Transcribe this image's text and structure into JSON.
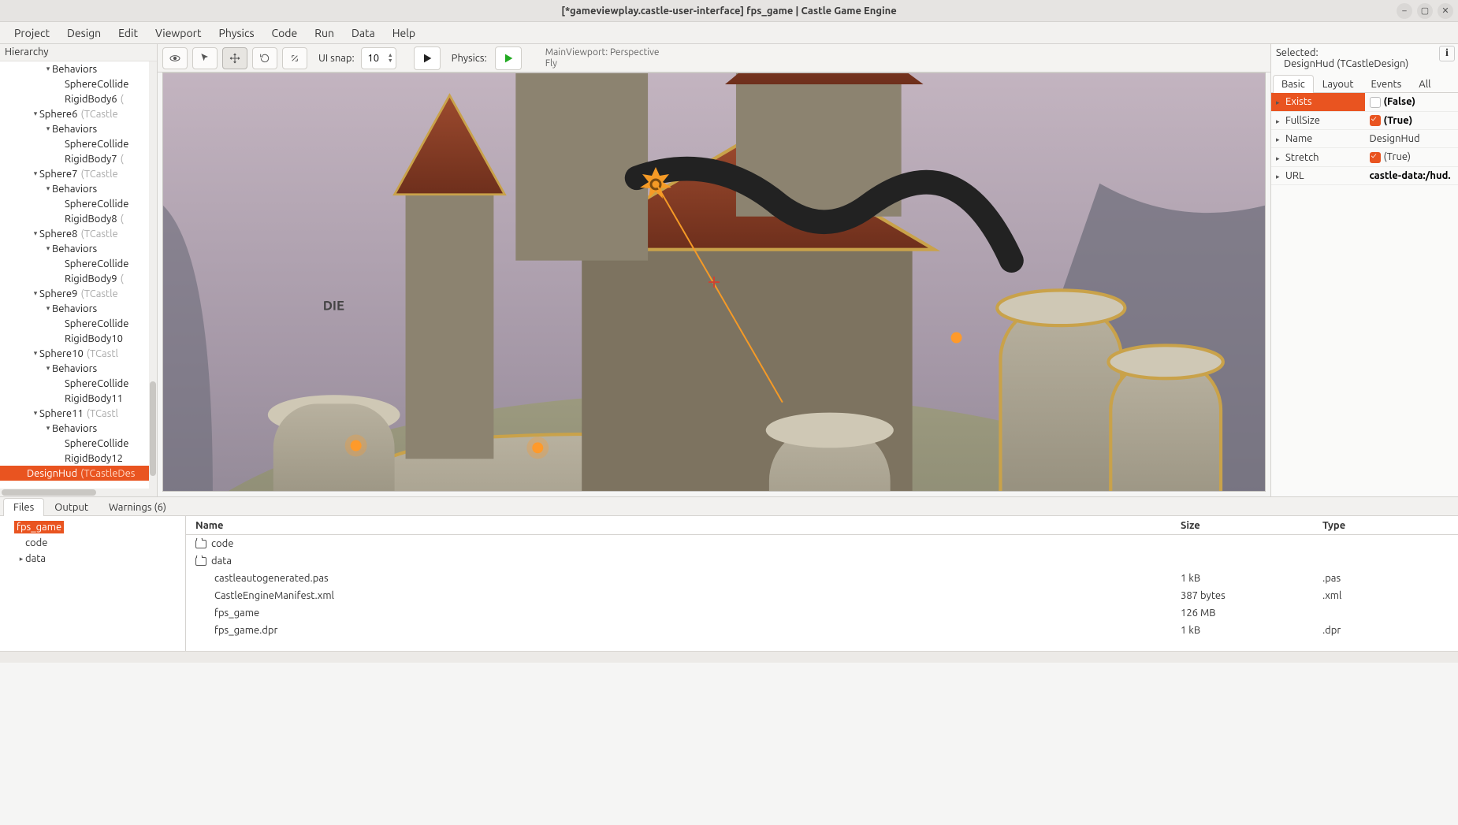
{
  "titlebar": {
    "title": "[*gameviewplay.castle-user-interface] fps_game | Castle Game Engine"
  },
  "menu": [
    "Project",
    "Design",
    "Edit",
    "Viewport",
    "Physics",
    "Code",
    "Run",
    "Data",
    "Help"
  ],
  "toolbar": {
    "ui_snap_label": "UI snap:",
    "ui_snap_value": "10",
    "physics_label": "Physics:",
    "info_line1": "MainViewport: Perspective",
    "info_line2": "Fly"
  },
  "hierarchy": {
    "header": "Hierarchy",
    "rows": [
      {
        "indent": 3,
        "arrow": "▾",
        "label": "Behaviors",
        "type": ""
      },
      {
        "indent": 4,
        "arrow": "",
        "label": "SphereCollide",
        "type": ""
      },
      {
        "indent": 4,
        "arrow": "",
        "label": "RigidBody6",
        "type": "("
      },
      {
        "indent": 2,
        "arrow": "▾",
        "label": "Sphere6",
        "type": "(TCastle"
      },
      {
        "indent": 3,
        "arrow": "▾",
        "label": "Behaviors",
        "type": ""
      },
      {
        "indent": 4,
        "arrow": "",
        "label": "SphereCollide",
        "type": ""
      },
      {
        "indent": 4,
        "arrow": "",
        "label": "RigidBody7",
        "type": "("
      },
      {
        "indent": 2,
        "arrow": "▾",
        "label": "Sphere7",
        "type": "(TCastle"
      },
      {
        "indent": 3,
        "arrow": "▾",
        "label": "Behaviors",
        "type": ""
      },
      {
        "indent": 4,
        "arrow": "",
        "label": "SphereCollide",
        "type": ""
      },
      {
        "indent": 4,
        "arrow": "",
        "label": "RigidBody8",
        "type": "("
      },
      {
        "indent": 2,
        "arrow": "▾",
        "label": "Sphere8",
        "type": "(TCastle"
      },
      {
        "indent": 3,
        "arrow": "▾",
        "label": "Behaviors",
        "type": ""
      },
      {
        "indent": 4,
        "arrow": "",
        "label": "SphereCollide",
        "type": ""
      },
      {
        "indent": 4,
        "arrow": "",
        "label": "RigidBody9",
        "type": "("
      },
      {
        "indent": 2,
        "arrow": "▾",
        "label": "Sphere9",
        "type": "(TCastle"
      },
      {
        "indent": 3,
        "arrow": "▾",
        "label": "Behaviors",
        "type": ""
      },
      {
        "indent": 4,
        "arrow": "",
        "label": "SphereCollide",
        "type": ""
      },
      {
        "indent": 4,
        "arrow": "",
        "label": "RigidBody10",
        "type": ""
      },
      {
        "indent": 2,
        "arrow": "▾",
        "label": "Sphere10",
        "type": "(TCastl"
      },
      {
        "indent": 3,
        "arrow": "▾",
        "label": "Behaviors",
        "type": ""
      },
      {
        "indent": 4,
        "arrow": "",
        "label": "SphereCollide",
        "type": ""
      },
      {
        "indent": 4,
        "arrow": "",
        "label": "RigidBody11",
        "type": ""
      },
      {
        "indent": 2,
        "arrow": "▾",
        "label": "Sphere11",
        "type": "(TCastl"
      },
      {
        "indent": 3,
        "arrow": "▾",
        "label": "Behaviors",
        "type": ""
      },
      {
        "indent": 4,
        "arrow": "",
        "label": "SphereCollide",
        "type": ""
      },
      {
        "indent": 4,
        "arrow": "",
        "label": "RigidBody12",
        "type": ""
      },
      {
        "indent": 1,
        "arrow": "",
        "label": "DesignHud",
        "type": "(TCastleDes",
        "selected": true
      }
    ]
  },
  "inspector": {
    "selected_label": "Selected:",
    "selected_value": "DesignHud (TCastleDesign)",
    "tabs": [
      "Basic",
      "Layout",
      "Events",
      "All"
    ],
    "props": [
      {
        "name": "Exists",
        "value": "(False)",
        "hl": true,
        "bold": true,
        "checkbox": "unchecked"
      },
      {
        "name": "FullSize",
        "value": "(True)",
        "checkbox": "checked",
        "bold": true
      },
      {
        "name": "Name",
        "value": "DesignHud"
      },
      {
        "name": "Stretch",
        "value": "(True)",
        "checkbox": "checked"
      },
      {
        "name": "URL",
        "value": "castle-data:/hud.",
        "bold": true
      }
    ]
  },
  "bottom": {
    "tabs": [
      "Files",
      "Output",
      "Warnings (6)"
    ],
    "folder_tree": [
      {
        "indent": 0,
        "arrow": "",
        "name": "fps_game",
        "selected": true
      },
      {
        "indent": 1,
        "arrow": "",
        "name": "code"
      },
      {
        "indent": 1,
        "arrow": "▸",
        "name": "data"
      }
    ],
    "columns": {
      "name": "Name",
      "size": "Size",
      "type": "Type"
    },
    "files": [
      {
        "icon": "folder",
        "name": "code",
        "size": "",
        "type": ""
      },
      {
        "icon": "folder",
        "name": "data",
        "size": "",
        "type": ""
      },
      {
        "icon": "",
        "name": "castleautogenerated.pas",
        "size": "1 kB",
        "type": ".pas"
      },
      {
        "icon": "",
        "name": "CastleEngineManifest.xml",
        "size": "387 bytes",
        "type": ".xml"
      },
      {
        "icon": "",
        "name": "fps_game",
        "size": "126 MB",
        "type": ""
      },
      {
        "icon": "",
        "name": "fps_game.dpr",
        "size": "1 kB",
        "type": ".dpr"
      }
    ]
  }
}
